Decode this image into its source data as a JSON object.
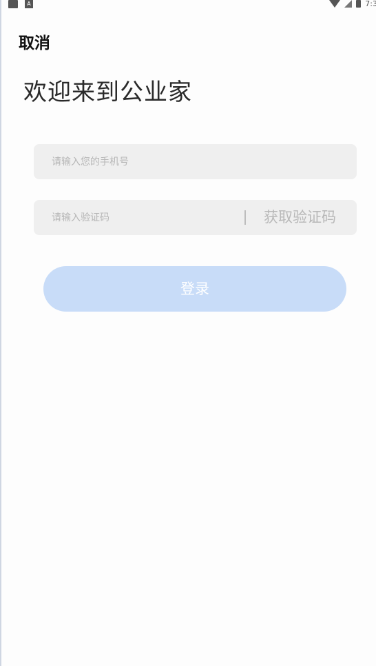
{
  "status_bar": {
    "left_icons": [
      "sim-card-icon",
      "notification-a-icon"
    ],
    "notification_glyph": "A",
    "right_icons": [
      "wifi-icon",
      "signal-icon",
      "battery-icon"
    ],
    "time": "7:3"
  },
  "header": {
    "cancel_label": "取消",
    "welcome_title": "欢迎来到公业家"
  },
  "form": {
    "phone": {
      "value": "",
      "placeholder": "请输入您的手机号"
    },
    "code": {
      "value": "",
      "placeholder": "请输入验证码"
    },
    "get_code_label": "获取验证码",
    "login_label": "登录"
  },
  "colors": {
    "background": "#fdfdfd",
    "field_background": "#efefef",
    "login_button_disabled": "#c8dcf8",
    "placeholder_text": "#b6b6b6"
  }
}
